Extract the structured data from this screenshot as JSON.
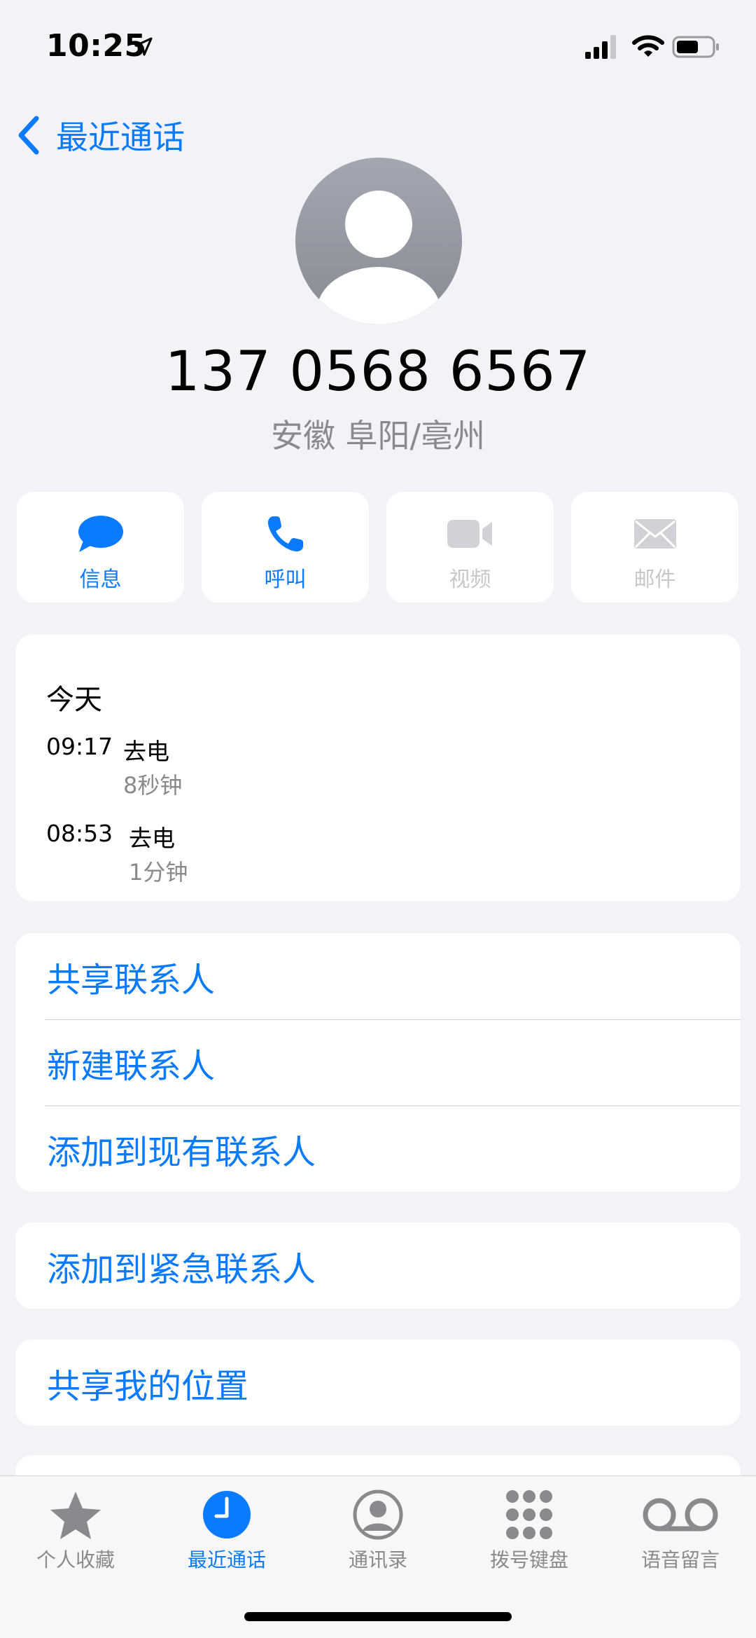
{
  "status": {
    "time": "10:25"
  },
  "nav": {
    "back_label": "最近通话"
  },
  "contact": {
    "number": "137 0568 6567",
    "location": "安徽 阜阳/亳州"
  },
  "actions": [
    {
      "label": "信息",
      "icon": "message-icon",
      "enabled": true
    },
    {
      "label": "呼叫",
      "icon": "phone-icon",
      "enabled": true
    },
    {
      "label": "视频",
      "icon": "video-icon",
      "enabled": false
    },
    {
      "label": "邮件",
      "icon": "mail-icon",
      "enabled": false
    }
  ],
  "recent_calls": {
    "heading": "今天",
    "items": [
      {
        "time": "09:17",
        "type": "去电",
        "duration": "8秒钟"
      },
      {
        "time": "08:53",
        "type": "去电",
        "duration": "1分钟"
      }
    ]
  },
  "options": {
    "share_contact": "共享联系人",
    "new_contact": "新建联系人",
    "add_existing": "添加到现有联系人",
    "add_emergency": "添加到紧急联系人",
    "share_location": "共享我的位置"
  },
  "tabs": [
    {
      "label": "个人收藏",
      "icon": "star-icon"
    },
    {
      "label": "最近通话",
      "icon": "clock-icon",
      "active": true
    },
    {
      "label": "通讯录",
      "icon": "contacts-icon"
    },
    {
      "label": "拨号键盘",
      "icon": "keypad-icon"
    },
    {
      "label": "语音留言",
      "icon": "voicemail-icon"
    }
  ],
  "colors": {
    "accent": "#0a7aff",
    "background": "#f2f2f7",
    "card": "#ffffff",
    "disabled": "#c7c7cc",
    "secondary_text": "#8a8a8e"
  }
}
